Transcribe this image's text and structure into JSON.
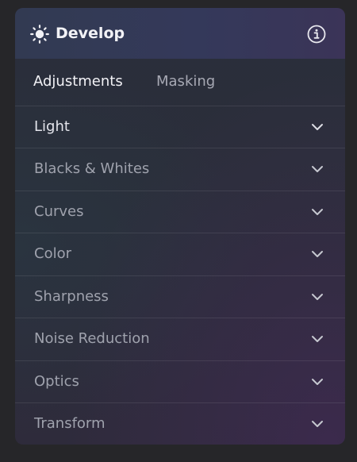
{
  "header": {
    "title": "Develop",
    "sun_icon": "sun-icon",
    "info_icon": "info-icon"
  },
  "tabs": [
    {
      "label": "Adjustments",
      "selected": true
    },
    {
      "label": "Masking",
      "selected": false
    }
  ],
  "sections": [
    {
      "label": "Light"
    },
    {
      "label": "Blacks & Whites"
    },
    {
      "label": "Curves"
    },
    {
      "label": "Color"
    },
    {
      "label": "Sharpness"
    },
    {
      "label": "Noise Reduction"
    },
    {
      "label": "Optics"
    },
    {
      "label": "Transform"
    }
  ],
  "colors": {
    "text_primary": "#f2f2f6",
    "text_secondary": "#9fa2ad",
    "header_bg": "#34395a"
  }
}
